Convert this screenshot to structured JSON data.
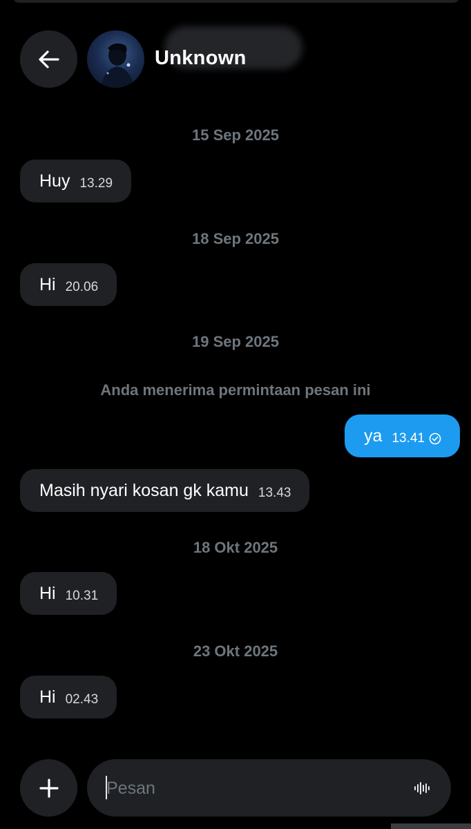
{
  "header": {
    "back_icon": "arrow-left-icon",
    "contact_name": "Unknown",
    "avatar_icon": "avatar-photo"
  },
  "messages": [
    {
      "type": "date",
      "text": "15 Sep 2025"
    },
    {
      "type": "incoming",
      "text": "Huy",
      "time": "13.29"
    },
    {
      "type": "date",
      "text": "18 Sep 2025"
    },
    {
      "type": "incoming",
      "text": "Hi",
      "time": "20.06"
    },
    {
      "type": "date",
      "text": "19 Sep 2025"
    },
    {
      "type": "system",
      "text": "Anda menerima permintaan pesan ini"
    },
    {
      "type": "outgoing",
      "text": "ya",
      "time": "13.41",
      "status_icon": "check-circle-icon"
    },
    {
      "type": "incoming",
      "text": "Masih nyari kosan gk kamu",
      "time": "13.43"
    },
    {
      "type": "date",
      "text": "18 Okt 2025"
    },
    {
      "type": "incoming",
      "text": "Hi",
      "time": "10.31"
    },
    {
      "type": "date",
      "text": "23 Okt 2025"
    },
    {
      "type": "incoming",
      "text": "Hi",
      "time": "02.43"
    }
  ],
  "composer": {
    "add_icon": "plus-icon",
    "placeholder": "Pesan",
    "value": "",
    "voice_icon": "voice-wave-icon"
  },
  "colors": {
    "background": "#000000",
    "bubble_incoming": "#1f2125",
    "bubble_outgoing": "#1d9bf0",
    "muted_text": "#6e767d"
  }
}
